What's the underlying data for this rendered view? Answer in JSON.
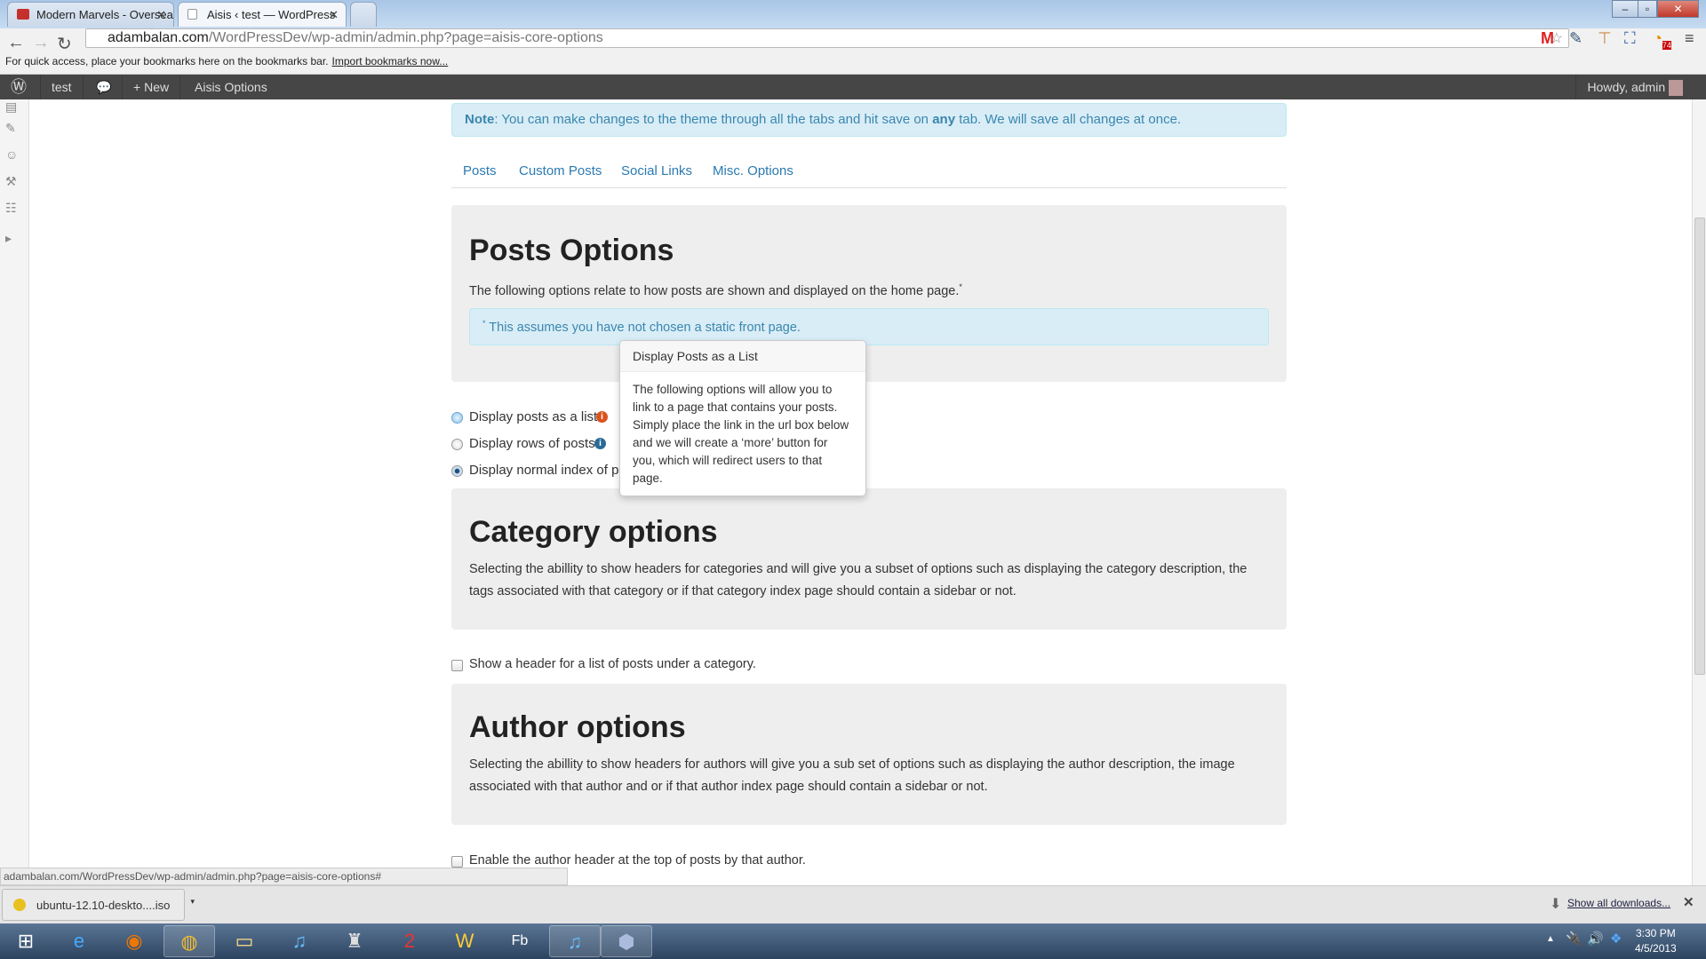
{
  "browser": {
    "tabs": [
      {
        "title": "Modern Marvels - Oversea",
        "icon": "youtube-icon"
      },
      {
        "title": "Aisis ‹ test — WordPress",
        "icon": "page-icon"
      }
    ],
    "url_host": "adambalan.com",
    "url_path": "/WordPressDev/wp-admin/admin.php?page=aisis-core-options",
    "bookmarks_hint": "For quick access, place your bookmarks here on the bookmarks bar.",
    "import_link": "Import bookmarks now...",
    "rss_count": "74",
    "status_url": "adambalan.com/WordPressDev/wp-admin/admin.php?page=aisis-core-options#",
    "download_file": "ubuntu-12.10-deskto....iso",
    "show_all_downloads": "Show all downloads..."
  },
  "adminbar": {
    "site": "test",
    "new": "New",
    "options": "Aisis Options",
    "howdy": "Howdy, admin"
  },
  "note": {
    "label": "Note",
    "text1": ": You can make changes to the theme through all the tabs and hit save on ",
    "bold": "any",
    "text2": " tab. We will save all changes at once."
  },
  "tabs": [
    "Posts",
    "Custom Posts",
    "Social Links",
    "Misc. Options"
  ],
  "posts": {
    "title": "Posts Options",
    "desc": "The following options relate to how posts are shown and displayed on the home page.",
    "sup": "*",
    "footnote": "This assumes you have not chosen a static front page.",
    "options": [
      {
        "label": "Display posts as a list.",
        "selected": false,
        "info_color": "#d9531e"
      },
      {
        "label": "Display rows of posts.",
        "selected": false,
        "info_color": "#2a6a96"
      },
      {
        "label": "Display normal index of posts.",
        "selected": true
      }
    ]
  },
  "tooltip": {
    "title": "Display Posts as a List",
    "body": "The following options will allow you to link to a page that contains your posts. Simply place the link in the url box below and we will create a ‘more’ button for you, which will redirect users to that page."
  },
  "category": {
    "title": "Category options",
    "desc": "Selecting the abillity to show headers for categories and will give you a subset of options such as displaying the category description, the tags associated with that category or if that category index page should contain a sidebar or not.",
    "checkbox": "Show a header for a list of posts under a category.",
    "checked": false
  },
  "author": {
    "title": "Author options",
    "desc": "Selecting the abillity to show headers for authors will give you a sub set of options such as displaying the author description, the image associated with that author and or if that author index page should contain a sidebar or not.",
    "checkbox": "Enable the author header at the top of posts by that author.",
    "checked": false
  },
  "clock": {
    "time": "3:30 PM",
    "date": "4/5/2013"
  }
}
